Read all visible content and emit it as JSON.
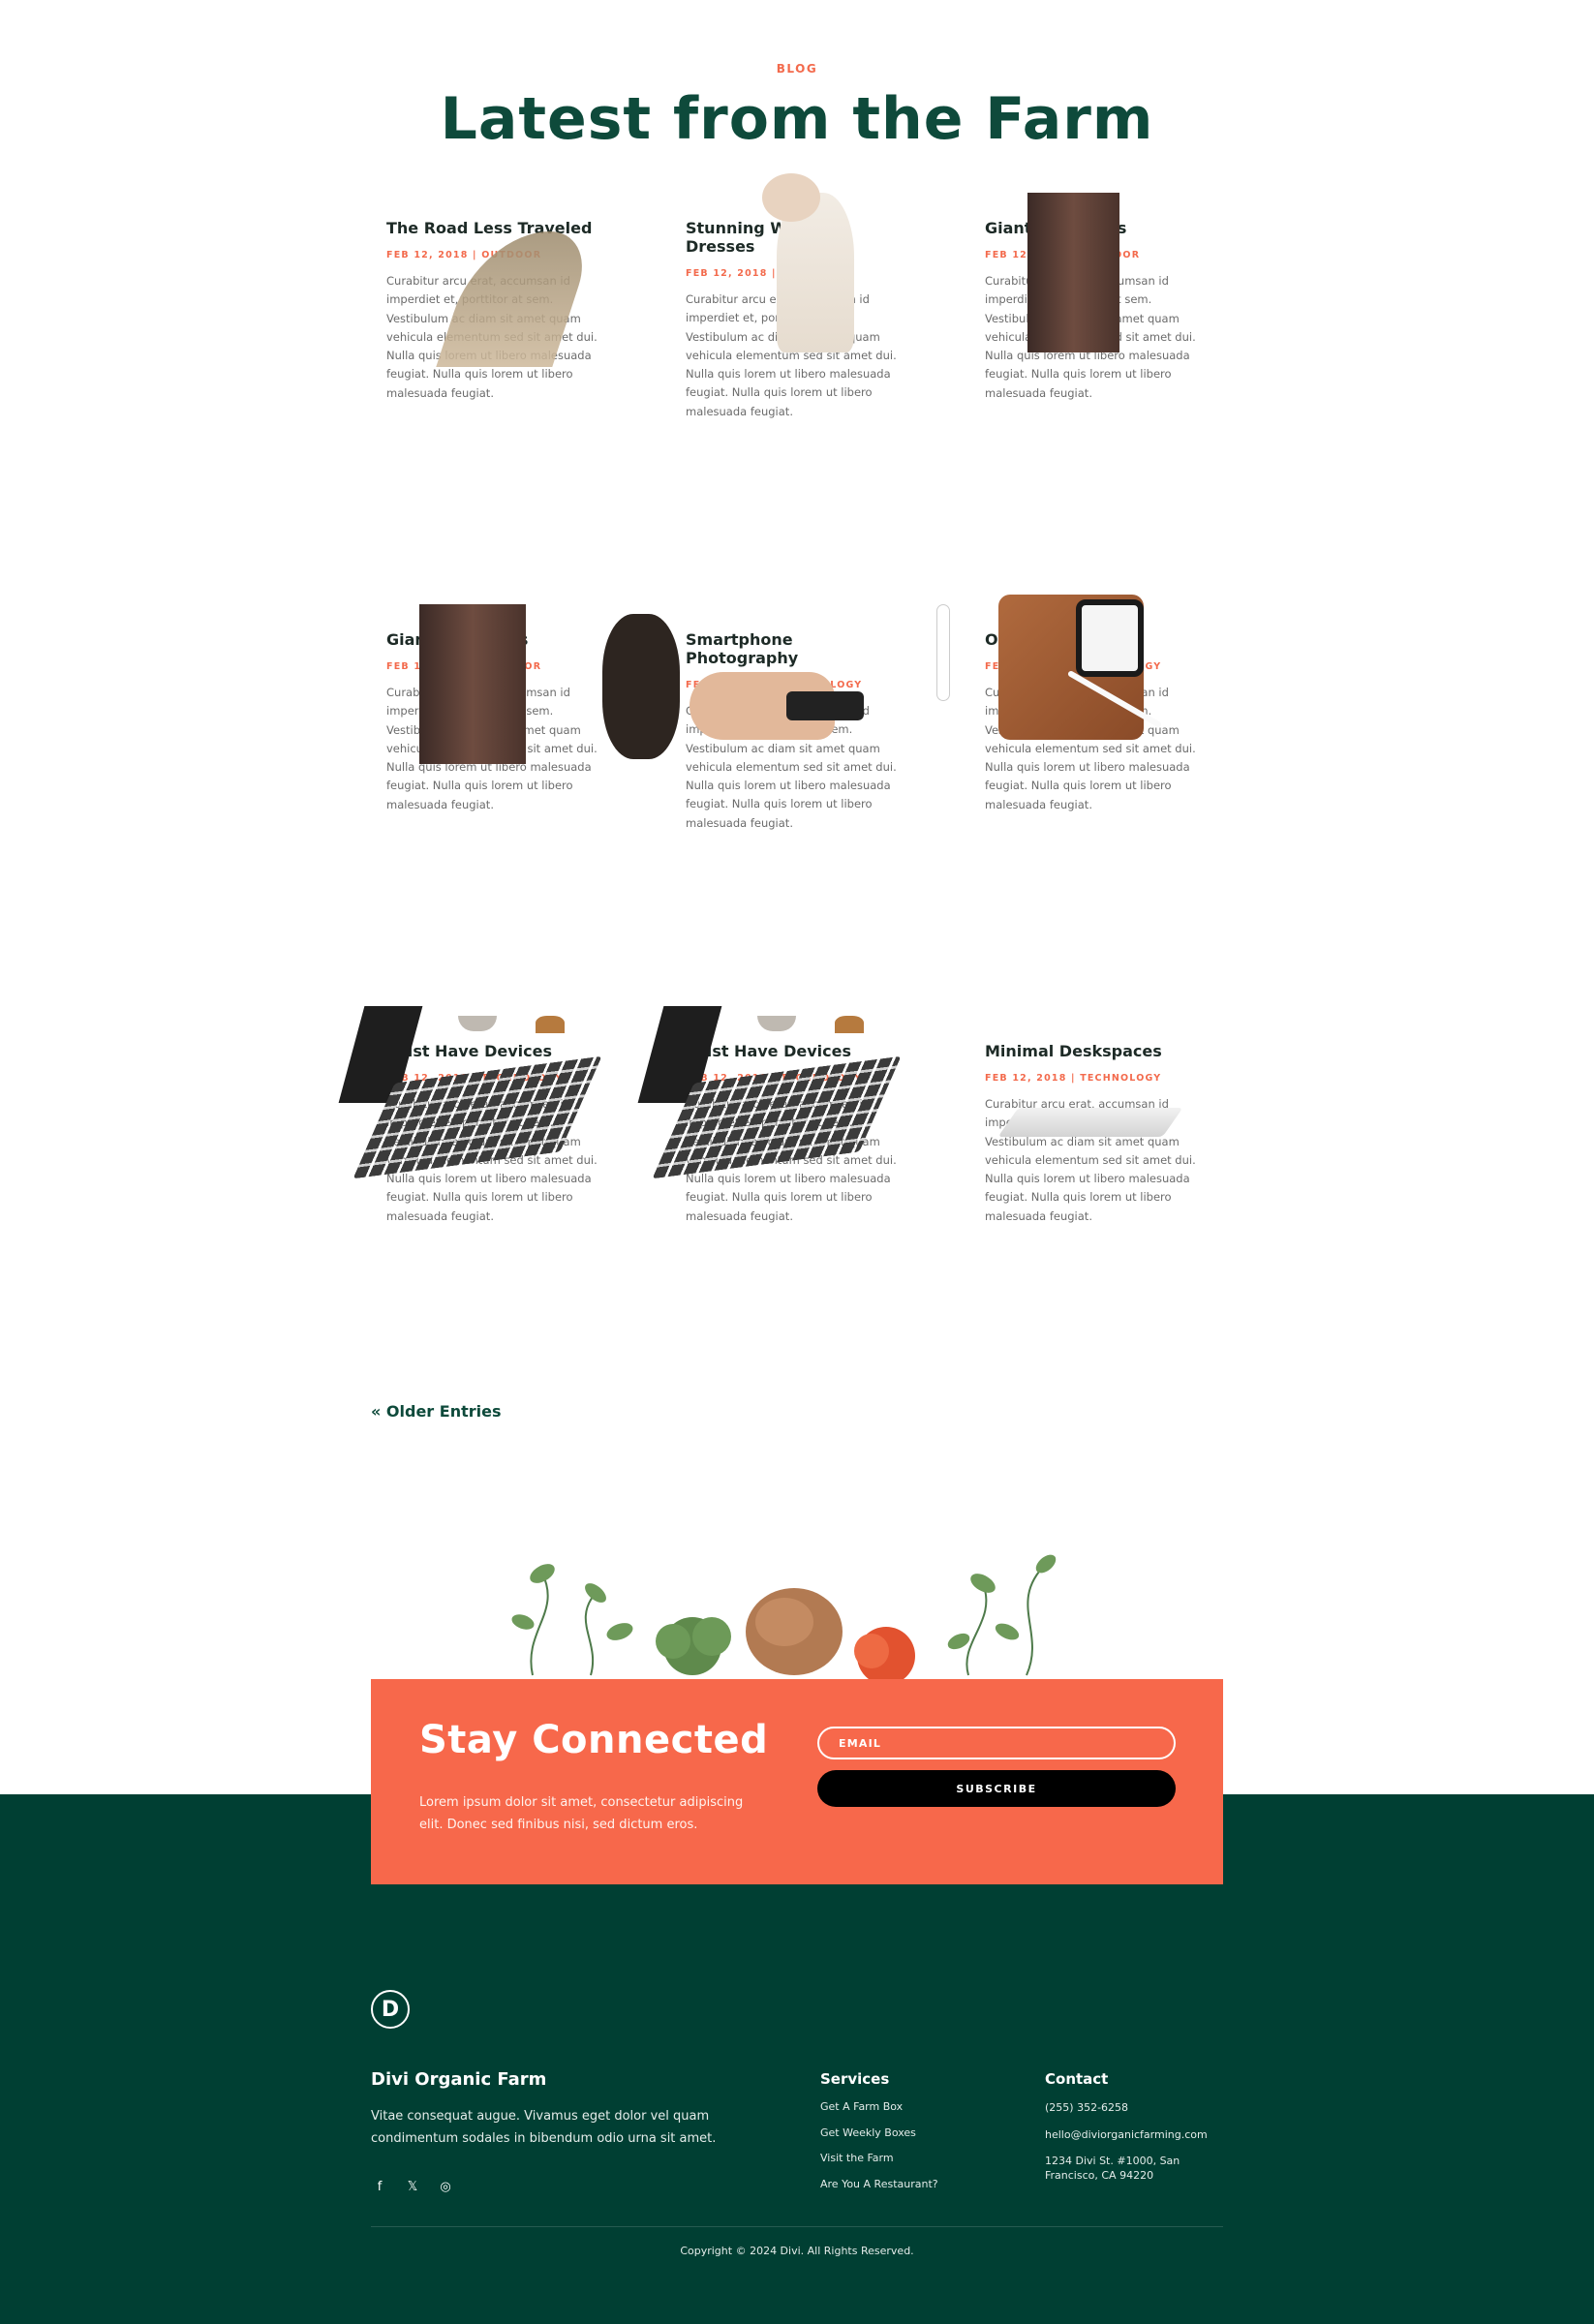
{
  "blog": {
    "eyebrow": "BLOG",
    "title": "Latest from the Farm",
    "posts": [
      {
        "title": "The Road Less Traveled",
        "meta": "FEB 12, 2018 | OUTDOOR",
        "excerpt": "Curabitur arcu erat, accumsan id imperdiet et, porttitor at sem. Vestibulum ac diam sit amet quam vehicula elementum sed sit amet dui. Nulla quis lorem ut libero malesuada feugiat. Nulla quis lorem ut libero malesuada feugiat."
      },
      {
        "title": "Stunning Wedding Dresses",
        "meta": "FEB 12, 2018 | WEDDING",
        "excerpt": "Curabitur arcu erat, accumsan id imperdiet et, porttitor at sem. Vestibulum ac diam sit amet quam vehicula elementum sed sit amet dui. Nulla quis lorem ut libero malesuada feugiat. Nulla quis lorem ut libero malesuada feugiat."
      },
      {
        "title": "Giant Redwoods",
        "meta": "FEB 12, 2018 | OUTDOOR",
        "excerpt": "Curabitur arcu erat, accumsan id imperdiet et, porttitor at sem. Vestibulum ac diam sit amet quam vehicula elementum sed sit amet dui. Nulla quis lorem ut libero malesuada feugiat. Nulla quis lorem ut libero malesuada feugiat."
      },
      {
        "title": "Giant Redwoods",
        "meta": "FEB 12, 2018 | OUTDOOR",
        "excerpt": "Curabitur arcu erat, accumsan id imperdiet et, porttitor at sem. Vestibulum ac diam sit amet quam vehicula elementum sed sit amet dui. Nulla quis lorem ut libero malesuada feugiat. Nulla quis lorem ut libero malesuada feugiat."
      },
      {
        "title": "Smartphone Photography",
        "meta": "FEB 12, 2018 | TECHNOLOGY",
        "excerpt": "Curabitur arcu erat, accumsan id imperdiet et, porttitor at sem. Vestibulum ac diam sit amet quam vehicula elementum sed sit amet dui. Nulla quis lorem ut libero malesuada feugiat. Nulla quis lorem ut libero malesuada feugiat."
      },
      {
        "title": "On The Go",
        "meta": "FEB 12, 2018 | TECHNOLOGY",
        "excerpt": "Curabitur arcu erat, accumsan id imperdiet et, porttitor at sem. Vestibulum ac diam sit amet quam vehicula elementum sed sit amet dui. Nulla quis lorem ut libero malesuada feugiat. Nulla quis lorem ut libero malesuada feugiat."
      },
      {
        "title": "Must Have Devices",
        "meta": "FEB 12, 2018 | TECHNOLOGY",
        "excerpt": "Curabitur arcu erat, accumsan id imperdiet et, porttitor at sem. Vestibulum ac diam sit amet quam vehicula elementum sed sit amet dui. Nulla quis lorem ut libero malesuada feugiat. Nulla quis lorem ut libero malesuada feugiat."
      },
      {
        "title": "Must Have Devices",
        "meta": "FEB 12, 2018 | TECHNOLOGY",
        "excerpt": "Curabitur arcu erat, accumsan id imperdiet et, porttitor at sem. Vestibulum ac diam sit amet quam vehicula elementum sed sit amet dui. Nulla quis lorem ut libero malesuada feugiat. Nulla quis lorem ut libero malesuada feugiat."
      },
      {
        "title": "Minimal Deskspaces",
        "meta": "FEB 12, 2018 | TECHNOLOGY",
        "excerpt": "Curabitur arcu erat, accumsan id imperdiet et, porttitor at sem. Vestibulum ac diam sit amet quam vehicula elementum sed sit amet dui. Nulla quis lorem ut libero malesuada feugiat. Nulla quis lorem ut libero malesuada feugiat."
      }
    ],
    "older_entries": "« Older Entries"
  },
  "cta": {
    "title": "Stay Connected",
    "text": "Lorem ipsum dolor sit amet, consectetur adipiscing elit. Donec sed finibus nisi, sed dictum eros.",
    "email_placeholder": "EMAIL",
    "subscribe_label": "SUBSCRIBE"
  },
  "footer": {
    "logo_letter": "D",
    "brand_name": "Divi Organic Farm",
    "brand_text": "Vitae consequat augue. Vivamus eget dolor vel quam condimentum sodales in bibendum odio urna sit amet.",
    "socials": {
      "facebook": "f",
      "x": "𝕏",
      "instagram": "◎"
    },
    "services": {
      "title": "Services",
      "items": [
        "Get A Farm Box",
        "Get Weekly Boxes",
        "Visit the Farm",
        "Are You A Restaurant?"
      ]
    },
    "contact": {
      "title": "Contact",
      "phone": "(255) 352-6258",
      "email": "hello@diviorganicfarming.com",
      "address": "1234 Divi St. #1000, San Francisco, CA 94220"
    },
    "copyright": "Copyright © 2024 Divi. All Rights Reserved."
  },
  "colors": {
    "accent": "#f7684b",
    "brand_green": "#0e4a3b",
    "footer_bg": "#003f33"
  }
}
